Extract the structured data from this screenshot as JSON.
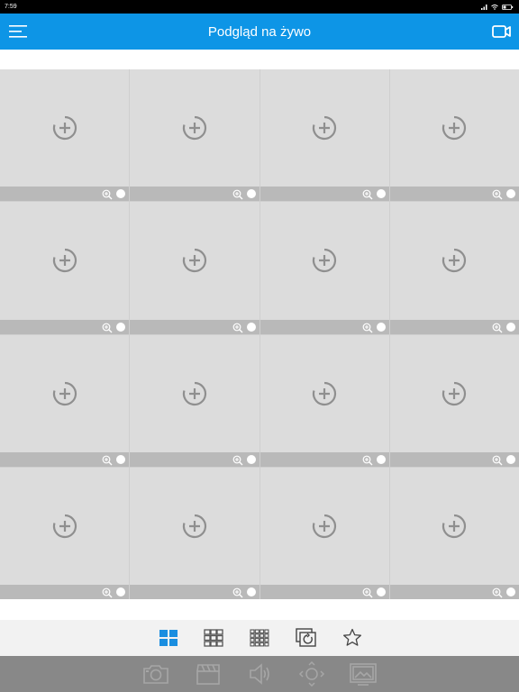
{
  "status_bar": {
    "time": "7:59"
  },
  "header": {
    "title": "Podgląd na żywo"
  },
  "grid": {
    "rows": 4,
    "columns": 4
  },
  "colors": {
    "header": "#0d95e6",
    "accent": "#1a8ee0",
    "tile": "#dcdcdc",
    "tile_bar": "#b9b9b9",
    "action_bar": "#888888"
  },
  "layout_bar": {
    "items": [
      {
        "icon": "layout-4-icon",
        "active": true
      },
      {
        "icon": "layout-9-icon",
        "active": false
      },
      {
        "icon": "layout-16-icon",
        "active": false
      },
      {
        "icon": "playback-icon",
        "active": false
      },
      {
        "icon": "favorites-star-icon",
        "active": false
      }
    ]
  },
  "action_bar": {
    "items": [
      {
        "icon": "snapshot-camera-icon"
      },
      {
        "icon": "record-clapper-icon"
      },
      {
        "icon": "audio-speaker-icon"
      },
      {
        "icon": "ptz-direction-icon"
      },
      {
        "icon": "image-settings-icon"
      }
    ]
  }
}
